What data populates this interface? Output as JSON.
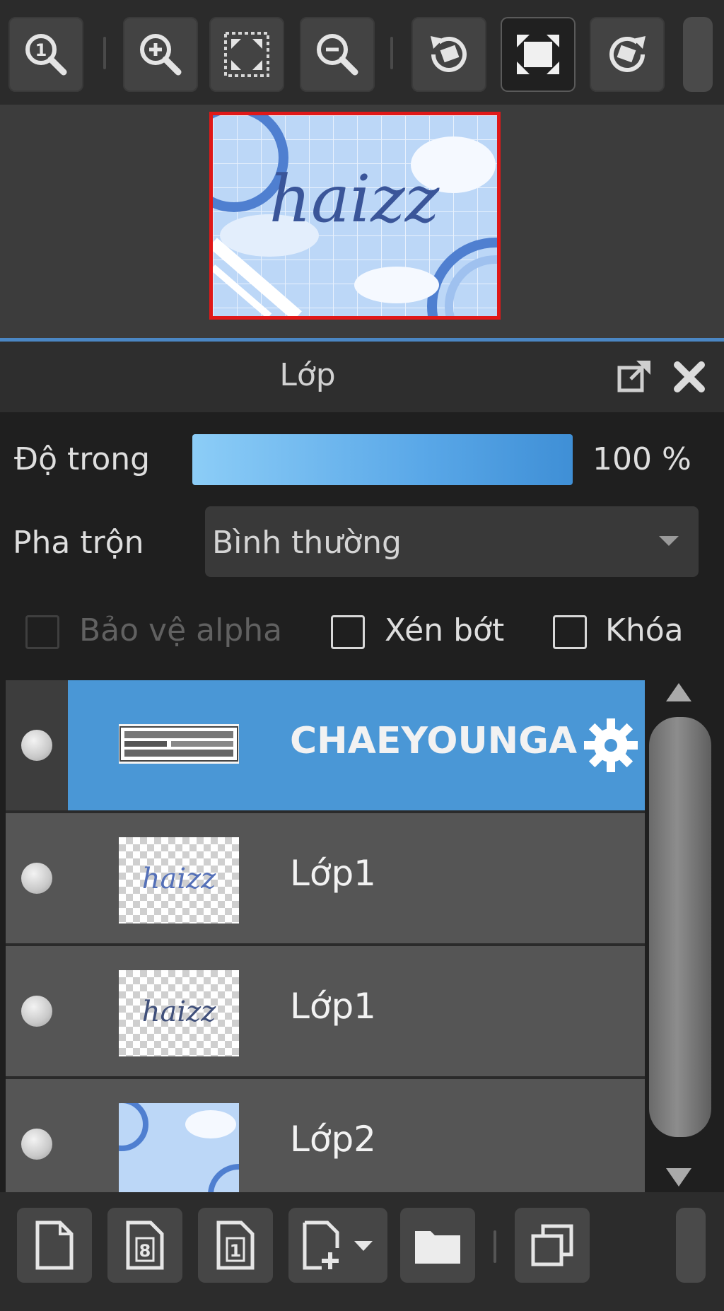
{
  "toolbar": {
    "buttons": [
      {
        "name": "zoom-actual-size-button",
        "icon": "zoom-1-icon"
      },
      {
        "name": "zoom-in-button",
        "icon": "zoom-in-icon"
      },
      {
        "name": "fit-screen-button",
        "icon": "fit-screen-icon"
      },
      {
        "name": "zoom-out-button",
        "icon": "zoom-out-icon"
      },
      {
        "name": "rotate-left-button",
        "icon": "rotate-left-icon"
      },
      {
        "name": "reset-view-button",
        "icon": "fullscreen-icon",
        "active": true
      },
      {
        "name": "rotate-right-button",
        "icon": "rotate-right-icon"
      }
    ]
  },
  "navigator": {
    "preview_text": "haizz"
  },
  "layer_panel": {
    "title": "Lớp",
    "opacity": {
      "label": "Độ trong",
      "value": 100,
      "display": "100 %"
    },
    "blend": {
      "label": "Pha trộn",
      "selected": "Bình thường"
    },
    "options": [
      {
        "label": "Bảo vệ alpha",
        "checked": false,
        "disabled": true
      },
      {
        "label": "Xén bớt",
        "checked": false,
        "disabled": false
      },
      {
        "label": "Khóa",
        "checked": false,
        "disabled": false
      }
    ],
    "layers": [
      {
        "name": "CHAEYOUNGA",
        "visible": true,
        "selected": true,
        "thumbnail": "text-strip"
      },
      {
        "name": "Lớp1",
        "visible": true,
        "selected": false,
        "thumbnail": "transparent-haizz"
      },
      {
        "name": "Lớp1",
        "visible": true,
        "selected": false,
        "thumbnail": "transparent-haizz"
      },
      {
        "name": "Lớp2",
        "visible": true,
        "selected": false,
        "thumbnail": "blue-background"
      }
    ]
  },
  "bottom_toolbar": {
    "buttons": [
      {
        "name": "new-layer-button",
        "icon": "new-page-icon"
      },
      {
        "name": "new-8bit-layer-button",
        "icon": "page-8-icon",
        "glyph": "8"
      },
      {
        "name": "new-1bit-layer-button",
        "icon": "page-1-icon",
        "glyph": "1"
      },
      {
        "name": "add-layer-menu-button",
        "icon": "add-page-dropdown-icon"
      },
      {
        "name": "new-folder-button",
        "icon": "folder-icon"
      },
      {
        "name": "duplicate-layer-button",
        "icon": "duplicate-icon"
      }
    ]
  },
  "colors": {
    "accent": "#4a97d6",
    "selection_border": "#e01818",
    "panel_bg": "#1f1f1f"
  }
}
